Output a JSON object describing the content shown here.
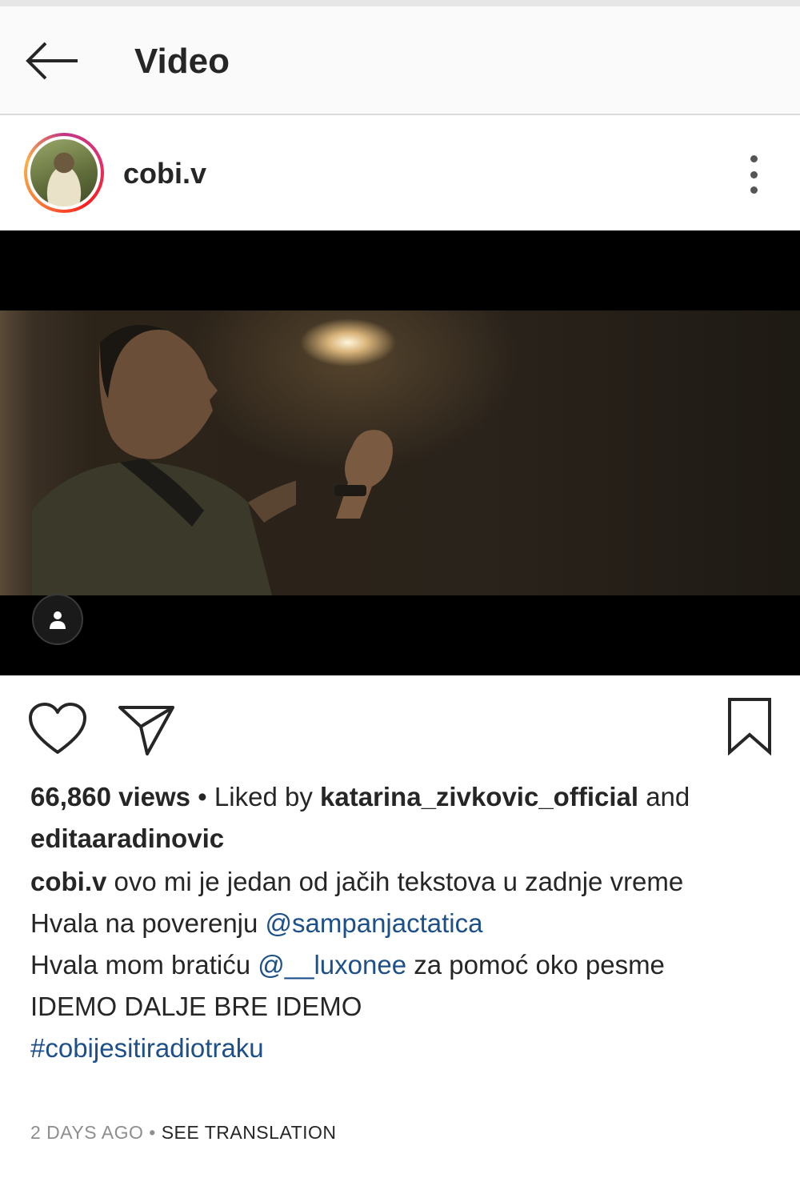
{
  "header": {
    "title": "Video"
  },
  "post": {
    "username": "cobi.v",
    "views_text": "66,860 views",
    "liked_by_prefix": "Liked by",
    "liked_by_user1": "katarina_zivkovic_official",
    "liked_by_and": "and",
    "liked_by_user2": "editaaradinovic",
    "caption_username": "cobi.v",
    "caption_line1": "ovo mi je jedan od jačih tekstova u zadnje vreme",
    "caption_line2_prefix": "Hvala na poverenju",
    "caption_line2_mention": "@sampanjactatica",
    "caption_line3_prefix": "Hvala mom bratiću",
    "caption_line3_mention": "@__luxonee",
    "caption_line3_suffix": "za pomoć oko pesme",
    "caption_line4": "IDEMO DALJE BRE IDEMO",
    "hashtag": "#cobijesitiradiotraku",
    "timestamp": "2 DAYS AGO",
    "separator": "•",
    "see_translation": "SEE TRANSLATION"
  },
  "icons": {
    "back": "arrow-left-icon",
    "more": "more-vertical-icon",
    "tagged": "user-tag-icon",
    "like": "heart-icon",
    "share": "paper-plane-icon",
    "save": "bookmark-icon"
  },
  "colors": {
    "link": "#1d4f8a",
    "meta": "#8e8e8e",
    "text": "#262626"
  }
}
